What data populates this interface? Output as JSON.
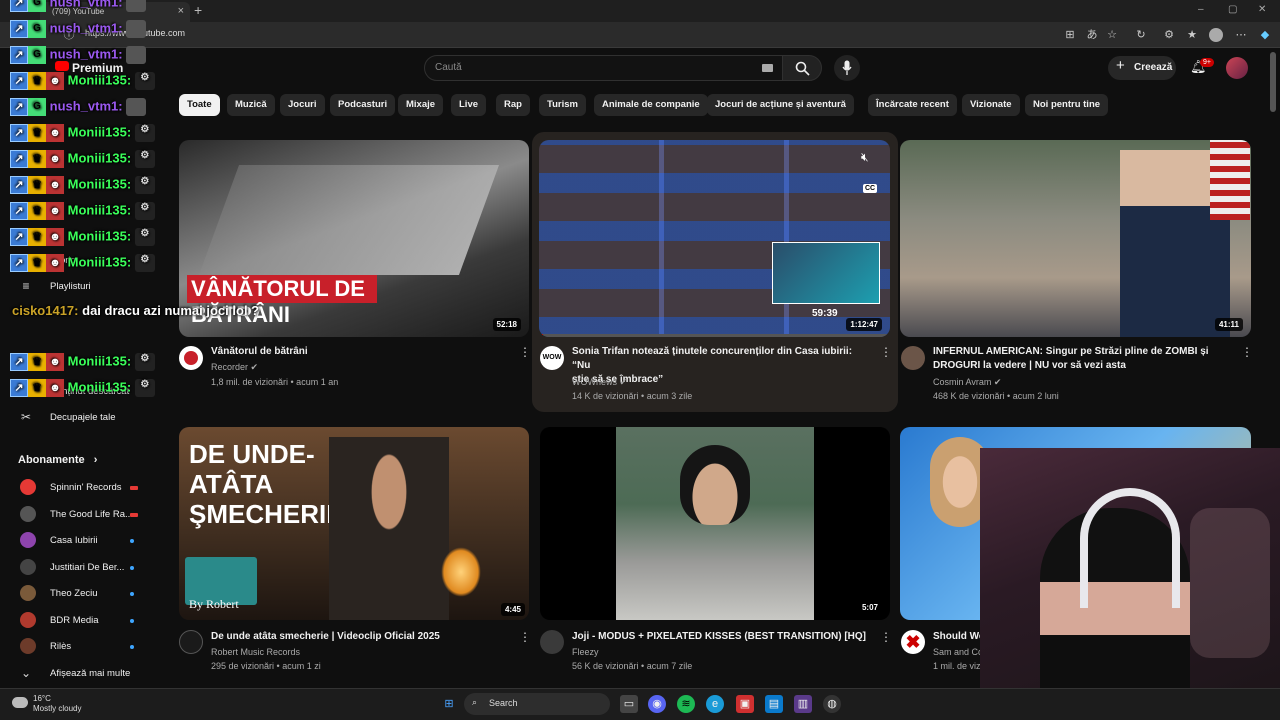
{
  "browser": {
    "tab_title": "(709) YouTube",
    "url": "https://www.youtube.com"
  },
  "header": {
    "search_placeholder": "Caută",
    "create_label": "Creează",
    "notif_count": "9+"
  },
  "chips": [
    "Toate",
    "Muzică",
    "Jocuri",
    "Podcasturi",
    "Mixaje",
    "Live",
    "Rap",
    "Turism",
    "Animale de companie",
    "Jocuri de acțiune și aventură",
    "Încărcate recent",
    "Vizionate",
    "Noi pentru tine"
  ],
  "sidebar": {
    "premium_label": "Premium",
    "items_mid": [
      {
        "label": "Istoric",
        "icon": "history-icon"
      },
      {
        "label": "Playlisturi",
        "icon": "playlist-icon"
      },
      {
        "label": "Conținut descărcat",
        "icon": "download-icon"
      },
      {
        "label": "Decupajele tale",
        "icon": "scissors-icon"
      }
    ],
    "subscriptions_title": "Abonamente",
    "subscriptions": [
      {
        "label": "Spinnin' Records",
        "color": "#e53935",
        "live": true
      },
      {
        "label": "The Good Life Ra...",
        "color": "#555555",
        "live": true
      },
      {
        "label": "Casa Iubirii",
        "color": "#8e44ad",
        "live": false
      },
      {
        "label": "Justitiari De Ber...",
        "color": "#444444",
        "live": false
      },
      {
        "label": "Theo Zeciu",
        "color": "#7a5a3a",
        "live": false
      },
      {
        "label": "BDR Media",
        "color": "#b03a2e",
        "live": false
      },
      {
        "label": "Rilès",
        "color": "#6d3b2a",
        "live": false
      }
    ],
    "show_more": "Afișează mai multe"
  },
  "chat": [
    {
      "user": "nush_vtm1:",
      "msg": "",
      "style": "n1"
    },
    {
      "user": "nush_vtm1:",
      "msg": "",
      "style": "n1"
    },
    {
      "user": "nush_vtm1:",
      "msg": "",
      "style": "n1"
    },
    {
      "user": "Moniii135:",
      "msg": "",
      "style": "n2"
    },
    {
      "user": "nush_vtm1:",
      "msg": "",
      "style": "n1"
    },
    {
      "user": "Moniii135:",
      "msg": "",
      "style": "n2"
    },
    {
      "user": "Moniii135:",
      "msg": "",
      "style": "n2"
    },
    {
      "user": "Moniii135:",
      "msg": "",
      "style": "n2"
    },
    {
      "user": "Moniii135:",
      "msg": "",
      "style": "n2"
    },
    {
      "user": "Moniii135:",
      "msg": "",
      "style": "n2"
    },
    {
      "user": "Moniii135:",
      "msg": "",
      "style": "n2"
    },
    {
      "user": "cisko1417:",
      "msg": "dai dracu azi numai joci lol ?",
      "style": "n3"
    },
    {
      "user": "Moniii135:",
      "msg": "",
      "style": "n2"
    },
    {
      "user": "Moniii135:",
      "msg": "",
      "style": "n2"
    }
  ],
  "videos": [
    {
      "title_l1": "Vânătorul de bătrâni",
      "title_l2": "",
      "channel": "Recorder",
      "meta": "1,8 mil. de vizionări • acum 1 an",
      "duration": "52:18",
      "thumb_text": "VÂNĂTORUL DE BĂTRÂNI"
    },
    {
      "title_l1": "Sonia Trifan notează ținutele concurenților din Casa iubirii: “Nu",
      "title_l2": "știe să se îmbrace”",
      "channel": "WOWnews",
      "meta": "14 K de vizionări • acum 3 zile",
      "duration": "1:12:47",
      "hover_time": "59:39",
      "chan_text": "WOW"
    },
    {
      "title_l1": "INFERNUL AMERICAN: Singur pe Străzi pline de ZOMBI și",
      "title_l2": "DROGURI la vedere | NU vor să vezi asta",
      "channel": "Cosmin Avram",
      "meta": "468 K de vizionări • acum 2 luni",
      "duration": "41:11"
    },
    {
      "title_l1": "De unde atâta smecherie  | Videoclip Oficial 2025",
      "title_l2": "",
      "channel": "Robert Music Records",
      "meta": "295 de vizionări • acum 1 zi",
      "duration": "4:45",
      "thumb_text": "DE UNDE-ATÂTA ŞMECHERIE",
      "thumb_sub": "By Robert"
    },
    {
      "title_l1": "Joji - MODUS + PIXELATED KISSES (BEST TRANSITION) [HQ]",
      "title_l2": "",
      "channel": "Fleezy",
      "meta": "56 K de vizionări • acum 7 zile",
      "duration": "5:07"
    },
    {
      "title_l1": "Should We",
      "title_l2": "",
      "channel": "Sam and Co",
      "meta": "1 mil. de viz",
      "duration": ""
    }
  ],
  "taskbar": {
    "temp": "16°C",
    "weather": "Mostly cloudy",
    "search": "Search"
  },
  "colors": {
    "accent": "#ff0000",
    "link": "#3ea6ff",
    "bg": "#0f0f0f"
  }
}
